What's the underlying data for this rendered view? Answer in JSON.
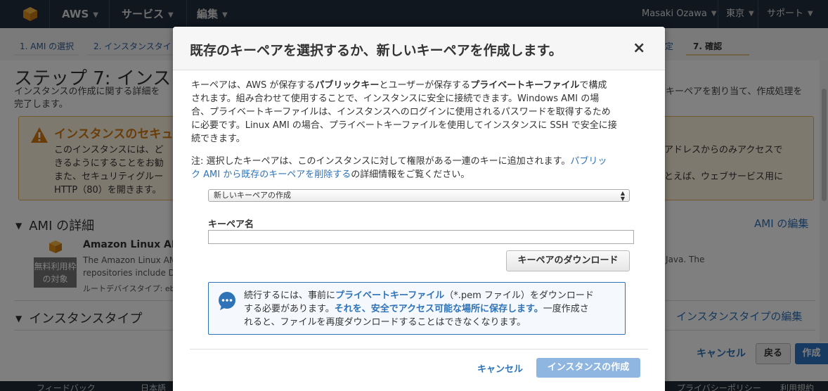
{
  "topnav": {
    "aws_label": "AWS",
    "services_label": "サービス",
    "edit_label": "編集",
    "user_label": "Masaki Ozawa",
    "region_label": "東京",
    "support_label": "サポート"
  },
  "wizard": {
    "tabs": [
      {
        "label": "1. AMI の選択"
      },
      {
        "label": "2. インスタンスタイ"
      },
      {
        "label": "定"
      },
      {
        "label": "7. 確認"
      }
    ]
  },
  "background": {
    "step_title": "ステップ 7: インスタ",
    "desc_line1": "インスタンスの作成に関する詳細を",
    "desc_line1_right": "キーペアを割り当て、作成処理を",
    "desc_line2": "完了します。",
    "warning_title": "インスタンスのセキュリ",
    "warning_lines": [
      "このインスタンスには、ど",
      "きるようにすることをお勧",
      "また、セキュリティグルー",
      "HTTP（80）を開きます。"
    ],
    "warning_lines_right": [
      "アドレスからのみアクセスで",
      "",
      "とえば、ウェブサービス用に"
    ],
    "ami_section_title": "AMI の詳細",
    "ami_edit_link": "AMI の編集",
    "ami_name": "Amazon Linux AM",
    "free_tier_line1": "無料利用枠",
    "free_tier_line2": "の対象",
    "ami_desc_line1": "The Amazon Linux AM",
    "ami_desc_line2": "repositories include D",
    "ami_desc_right": "nd Java. The",
    "root_device": "ルートデバイスタイプ: eb",
    "instance_type_title": "インスタンスタイプ",
    "instance_type_edit": "インスタンスタイプの編集",
    "cancel_label": "キャンセル",
    "back_label": "戻る",
    "create_label": "作成",
    "footer_feedback": "フィードバック",
    "footer_lang": "日本語",
    "footer_privacy": "プライバシーポリシー",
    "footer_terms": "利用規約"
  },
  "modal": {
    "title": "既存のキーペアを選択するか、新しいキーペアを作成します。",
    "close_symbol": "×",
    "p1_a": "キーペアは、AWS が保存する",
    "p1_b": "パブリックキー",
    "p1_c": "とユーザーが保存する",
    "p1_d": "プライベートキーファイル",
    "p1_e": "で構成",
    "p1_lines": [
      "されます。組み合わせて使用することで、インスタンスに安全に接続できます。Windows AMI の場",
      "合、プライベートキーファイルは、インスタンスへのログインに使用されるパスワードを取得するため",
      "に必要です。Linux AMI の場合、プライベートキーファイルを使用してインスタンスに SSH で安全に接",
      "続できます。"
    ],
    "note_a": "注: 選択したキーペアは、このインスタンスに対して権限がある一連のキーに追加されます。",
    "note_link_a": "パブリッ",
    "note_link_b": "ク AMI から既存のキーペアを削除する",
    "note_b": "の詳細情報をご覧ください。",
    "select_value": "新しいキーペアの作成",
    "keypair_label": "キーペア名",
    "keypair_value": "",
    "download_button": "キーペアのダウンロード",
    "info_l1_a": "続行するには、事前に",
    "info_l1_b": "プライベートキーファイル",
    "info_l1_c": "（*.pem ファイル）をダウンロード",
    "info_l2_a": "する必要があります。",
    "info_l2_b": "それを、安全でアクセス可能な場所に保存します。",
    "info_l2_c": "一度作成さ",
    "info_l3": "れると、ファイルを再度ダウンロードすることはできなくなります。",
    "cancel_label": "キャンセル",
    "launch_label": "インスタンスの作成"
  },
  "colors": {
    "nav_bg": "#232f3e",
    "link": "#2e73b8",
    "warning_accent": "#d47a10",
    "primary_disabled": "#8fb6e0",
    "primary": "#2d74c4"
  }
}
